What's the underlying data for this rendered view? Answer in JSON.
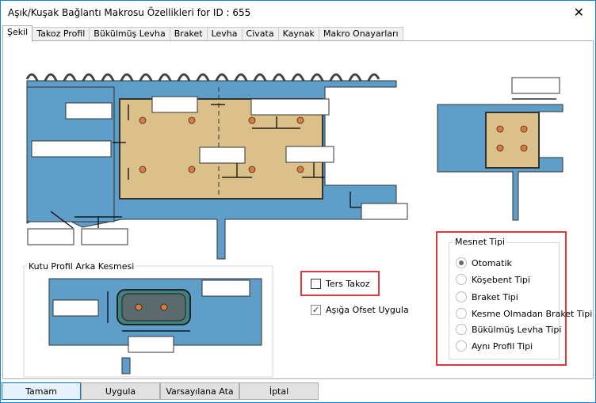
{
  "window": {
    "title": "Aşık/Kuşak Bağlantı Makrosu Özellikleri for ID : 655",
    "close_glyph": "✕"
  },
  "tabs": [
    {
      "label": "Şekil",
      "active": true
    },
    {
      "label": "Takoz Profil"
    },
    {
      "label": "Bükülmüş Levha"
    },
    {
      "label": "Braket"
    },
    {
      "label": "Levha"
    },
    {
      "label": "Civata"
    },
    {
      "label": "Kaynak"
    },
    {
      "label": "Makro Onayarları"
    }
  ],
  "section": {
    "box_profile_title": "Kutu Profil Arka Kesmesi"
  },
  "options": {
    "ters_takoz": {
      "label": "Ters Takoz",
      "checked": false
    },
    "ofset": {
      "label": "Aşığa Ofset Uygula",
      "checked": true,
      "mark": "✓"
    }
  },
  "support_type": {
    "title": "Mesnet Tipi",
    "items": [
      {
        "label": "Otomatik",
        "checked": true
      },
      {
        "label": "Köşebent Tipi",
        "checked": false
      },
      {
        "label": "Braket Tipi",
        "checked": false
      },
      {
        "label": "Kesme Olmadan Braket Tipi",
        "checked": false
      },
      {
        "label": "Bükülmüş Levha Tipi",
        "checked": false
      },
      {
        "label": "Aynı Profil Tipi",
        "checked": false
      }
    ]
  },
  "buttons": {
    "ok": "Tamam",
    "apply": "Uygula",
    "defaults": "Varsayılana Ata",
    "cancel": "İptal"
  },
  "colors": {
    "steel": "#5e9ec8",
    "plate": "#dcc08a",
    "bolt": "#e07a3a",
    "highlight": "#e0393e"
  }
}
